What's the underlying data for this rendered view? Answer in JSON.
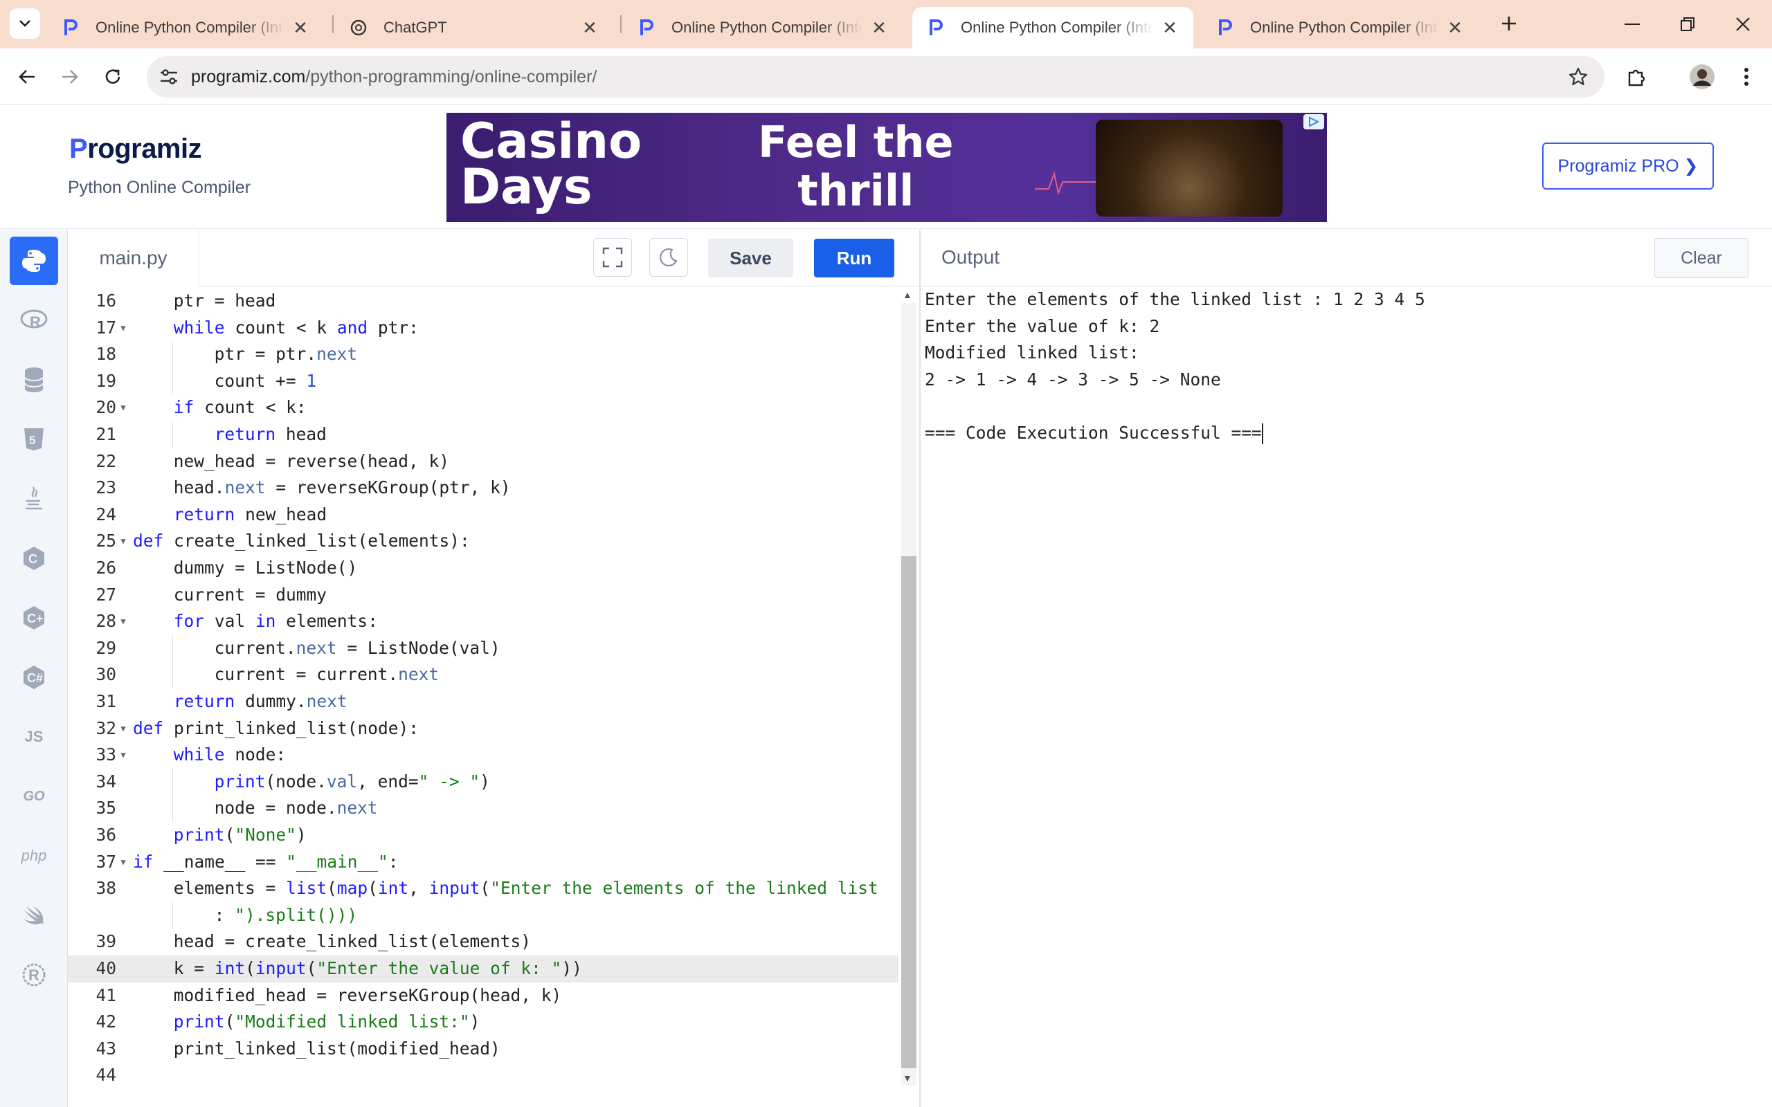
{
  "browser": {
    "tabs": [
      {
        "title": "Online Python Compiler (Interpreter)",
        "favicon": "programiz-icon",
        "active": false
      },
      {
        "title": "ChatGPT",
        "favicon": "chatgpt-icon",
        "active": false
      },
      {
        "title": "Online Python Compiler (Interpreter)",
        "favicon": "programiz-icon",
        "active": false
      },
      {
        "title": "Online Python Compiler (Interpreter)",
        "favicon": "programiz-icon",
        "active": true
      },
      {
        "title": "Online Python Compiler (Interpreter)",
        "favicon": "programiz-icon",
        "active": false
      }
    ],
    "url_host": "programiz.com",
    "url_path": "/python-programming/online-compiler/"
  },
  "header": {
    "logo_first": "P",
    "logo_rest": "rogramiz",
    "subtitle": "Python Online Compiler",
    "pro_button": "Programiz PRO ❯",
    "ad": {
      "line1": "Casino",
      "line2": "Days",
      "line3": "Feel the",
      "line4": "thrill"
    }
  },
  "rail": {
    "languages": [
      "python-icon",
      "r-icon",
      "sql-icon",
      "html-icon",
      "java-icon",
      "c-icon",
      "cpp-icon",
      "csharp-icon",
      "js-icon",
      "go-icon",
      "php-icon",
      "swift-icon",
      "rust-icon"
    ],
    "labels": {
      "js": "JS",
      "go": "GO",
      "php": "php"
    }
  },
  "editor": {
    "file_name": "main.py",
    "save_label": "Save",
    "run_label": "Run",
    "lines": [
      {
        "n": "16",
        "fold": false,
        "indent": 1,
        "code": "ptr = head"
      },
      {
        "n": "17",
        "fold": true,
        "indent": 1,
        "code": "while count < k and ptr:"
      },
      {
        "n": "18",
        "fold": false,
        "indent": 2,
        "code": "ptr = ptr.next"
      },
      {
        "n": "19",
        "fold": false,
        "indent": 2,
        "code": "count += 1"
      },
      {
        "n": "20",
        "fold": true,
        "indent": 1,
        "code": "if count < k:"
      },
      {
        "n": "21",
        "fold": false,
        "indent": 2,
        "code": "return head"
      },
      {
        "n": "22",
        "fold": false,
        "indent": 1,
        "code": "new_head = reverse(head, k)"
      },
      {
        "n": "23",
        "fold": false,
        "indent": 1,
        "code": "head.next = reverseKGroup(ptr, k)"
      },
      {
        "n": "24",
        "fold": false,
        "indent": 1,
        "code": "return new_head"
      },
      {
        "n": "25",
        "fold": true,
        "indent": 0,
        "code": "def create_linked_list(elements):"
      },
      {
        "n": "26",
        "fold": false,
        "indent": 1,
        "code": "dummy = ListNode()"
      },
      {
        "n": "27",
        "fold": false,
        "indent": 1,
        "code": "current = dummy"
      },
      {
        "n": "28",
        "fold": true,
        "indent": 1,
        "code": "for val in elements:"
      },
      {
        "n": "29",
        "fold": false,
        "indent": 2,
        "code": "current.next = ListNode(val)"
      },
      {
        "n": "30",
        "fold": false,
        "indent": 2,
        "code": "current = current.next"
      },
      {
        "n": "31",
        "fold": false,
        "indent": 1,
        "code": "return dummy.next"
      },
      {
        "n": "32",
        "fold": true,
        "indent": 0,
        "code": "def print_linked_list(node):"
      },
      {
        "n": "33",
        "fold": true,
        "indent": 1,
        "code": "while node:"
      },
      {
        "n": "34",
        "fold": false,
        "indent": 2,
        "code": "print(node.val, end=\" -> \")"
      },
      {
        "n": "35",
        "fold": false,
        "indent": 2,
        "code": "node = node.next"
      },
      {
        "n": "36",
        "fold": false,
        "indent": 1,
        "code": "print(\"None\")"
      },
      {
        "n": "37",
        "fold": true,
        "indent": 0,
        "code": "if __name__ == \"__main__\":"
      },
      {
        "n": "38",
        "fold": false,
        "indent": 1,
        "code": "elements = list(map(int, input(\"Enter the elements of the linked list"
      },
      {
        "n": "",
        "fold": false,
        "indent": 2,
        "code": ": \").split()))"
      },
      {
        "n": "39",
        "fold": false,
        "indent": 1,
        "code": "head = create_linked_list(elements)"
      },
      {
        "n": "40",
        "fold": false,
        "indent": 1,
        "code": "k = int(input(\"Enter the value of k: \"))",
        "highlight": true
      },
      {
        "n": "41",
        "fold": false,
        "indent": 1,
        "code": "modified_head = reverseKGroup(head, k)"
      },
      {
        "n": "42",
        "fold": false,
        "indent": 1,
        "code": "print(\"Modified linked list:\")"
      },
      {
        "n": "43",
        "fold": false,
        "indent": 1,
        "code": "print_linked_list(modified_head)"
      },
      {
        "n": "44",
        "fold": false,
        "indent": 0,
        "code": ""
      }
    ]
  },
  "output": {
    "title": "Output",
    "clear_label": "Clear",
    "lines": [
      "Enter the elements of the linked list : 1 2 3 4 5",
      "Enter the value of k: 2",
      "Modified linked list:",
      "2 -> 1 -> 4 -> 3 -> 5 -> None",
      "",
      "=== Code Execution Successful ==="
    ]
  }
}
